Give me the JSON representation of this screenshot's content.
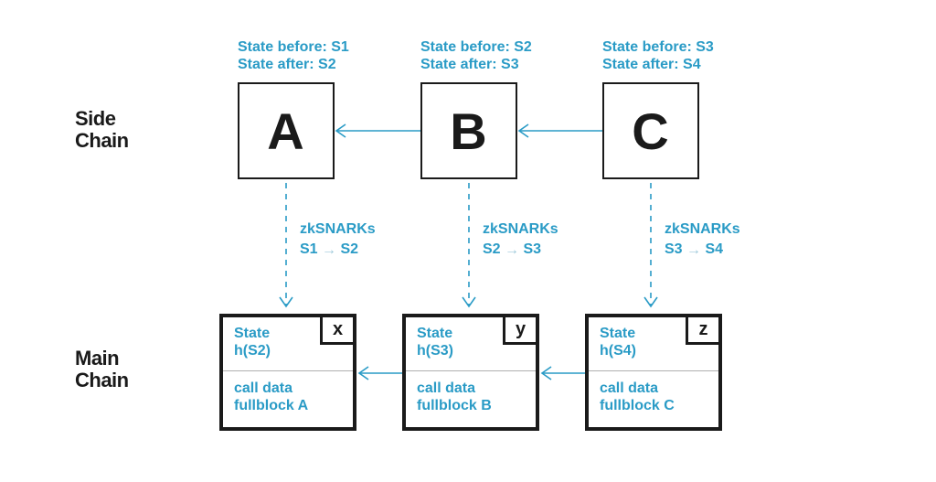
{
  "labels": {
    "side_chain": "Side\nChain",
    "main_chain": "Main\nChain"
  },
  "side_blocks": [
    {
      "letter": "A",
      "state_before": "State before: S1",
      "state_after": "State after: S2"
    },
    {
      "letter": "B",
      "state_before": "State before: S2",
      "state_after": "State after: S3"
    },
    {
      "letter": "C",
      "state_before": "State before: S3",
      "state_after": "State after: S4"
    }
  ],
  "zks": [
    {
      "title": "zkSNARKs",
      "from": "S1",
      "to": "S2"
    },
    {
      "title": "zkSNARKs",
      "from": "S2",
      "to": "S3"
    },
    {
      "title": "zkSNARKs",
      "from": "S3",
      "to": "S4"
    }
  ],
  "main_blocks": [
    {
      "tag": "x",
      "state_label": "State",
      "state_hash": "h(S2)",
      "calldata_l1": "call data",
      "calldata_l2": "fullblock A"
    },
    {
      "tag": "y",
      "state_label": "State",
      "state_hash": "h(S3)",
      "calldata_l1": "call data",
      "calldata_l2": "fullblock B"
    },
    {
      "tag": "z",
      "state_label": "State",
      "state_hash": "h(S4)",
      "calldata_l1": "call data",
      "calldata_l2": "fullblock C"
    }
  ]
}
